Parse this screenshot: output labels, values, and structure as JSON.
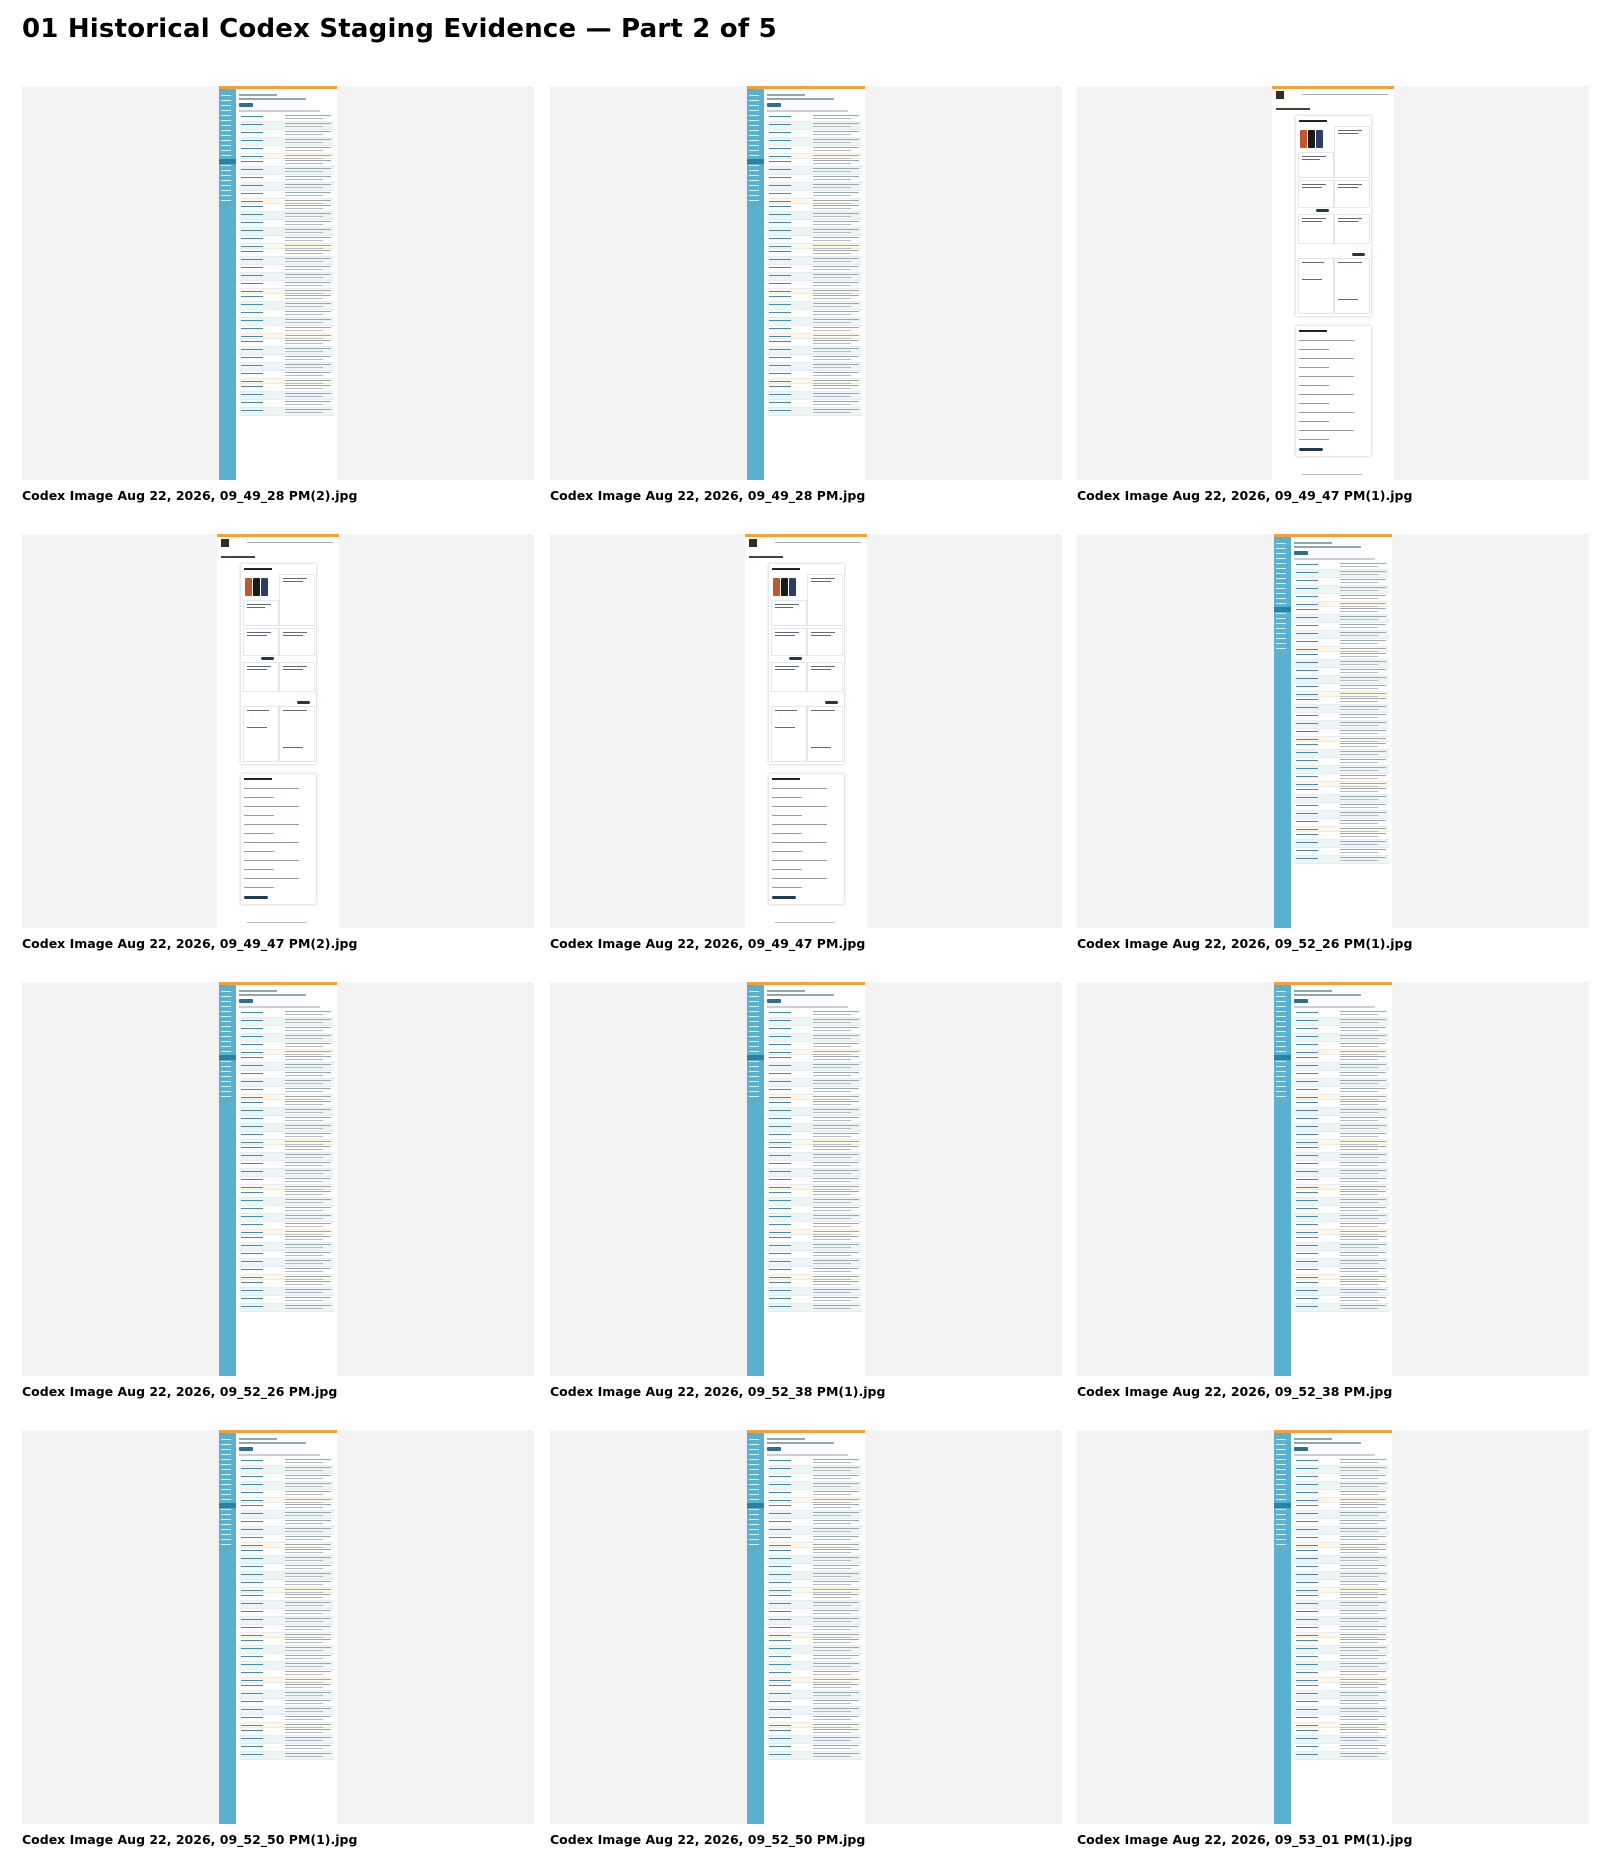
{
  "page": {
    "title": "01 Historical Codex Staging Evidence — Part 2 of 5"
  },
  "thumbnails": [
    {
      "caption": "Codex Image Aug 22, 2026, 09_49_28 PM(2).jpg",
      "kind": "admin-list"
    },
    {
      "caption": "Codex Image Aug 22, 2026, 09_49_28 PM.jpg",
      "kind": "admin-list"
    },
    {
      "caption": "Codex Image Aug 22, 2026, 09_49_47 PM(1).jpg",
      "kind": "customer-stories"
    },
    {
      "caption": "Codex Image Aug 22, 2026, 09_49_47 PM(2).jpg",
      "kind": "customer-stories"
    },
    {
      "caption": "Codex Image Aug 22, 2026, 09_49_47 PM.jpg",
      "kind": "customer-stories"
    },
    {
      "caption": "Codex Image Aug 22, 2026, 09_52_26 PM(1).jpg",
      "kind": "admin-list"
    },
    {
      "caption": "Codex Image Aug 22, 2026, 09_52_26 PM.jpg",
      "kind": "admin-list"
    },
    {
      "caption": "Codex Image Aug 22, 2026, 09_52_38 PM(1).jpg",
      "kind": "admin-list"
    },
    {
      "caption": "Codex Image Aug 22, 2026, 09_52_38 PM.jpg",
      "kind": "admin-list"
    },
    {
      "caption": "Codex Image Aug 22, 2026, 09_52_50 PM(1).jpg",
      "kind": "admin-list"
    },
    {
      "caption": "Codex Image Aug 22, 2026, 09_52_50 PM.jpg",
      "kind": "admin-list"
    },
    {
      "caption": "Codex Image Aug 22, 2026, 09_53_01 PM(1).jpg",
      "kind": "admin-list"
    }
  ],
  "colors": {
    "frame_bg": "#f3f3f3",
    "sidebar": "#5ab0cf",
    "topbar": "#f0a23c",
    "text": "#000000"
  }
}
